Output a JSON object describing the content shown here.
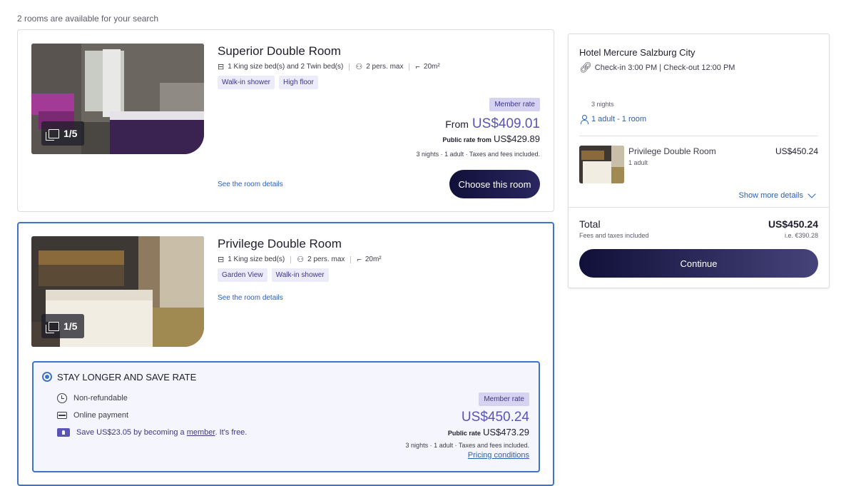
{
  "results": {
    "available_text": "2 rooms are available for your search"
  },
  "rooms": [
    {
      "name": "Superior Double Room",
      "photo_count": "1/5",
      "beds": "1 King size bed(s) and 2 Twin bed(s)",
      "max": "2 pers. max",
      "size": "20m²",
      "tags": [
        "Walk-in shower",
        "High floor"
      ],
      "details_link": "See the room details",
      "member_rate": "Member rate",
      "from_label": "From",
      "from_price": "US$409.01",
      "public_label": "Public rate from",
      "public_price": "US$429.89",
      "taxes_note": "3 nights · 1 adult · Taxes and fees included.",
      "choose_label": "Choose this room"
    },
    {
      "name": "Privilege Double Room",
      "photo_count": "1/5",
      "beds": "1 King size bed(s)",
      "max": "2 pers. max",
      "size": "20m²",
      "tags": [
        "Garden View",
        "Walk-in shower"
      ],
      "details_link": "See the room details",
      "rate": {
        "title": "STAY LONGER AND SAVE RATE",
        "non_refundable": "Non-refundable",
        "payment": "Online payment",
        "save_prefix": "Save US$23.05 by becoming a ",
        "save_link": "member",
        "save_suffix": ". It's free.",
        "member_rate": "Member rate",
        "price": "US$450.24",
        "public_label": "Public rate",
        "public_price": "US$473.29",
        "taxes_note": "3 nights · 1 adult · Taxes and fees included.",
        "pricing_conditions": "Pricing conditions"
      }
    }
  ],
  "summary": {
    "hotel_name": "Hotel Mercure Salzburg City",
    "check_times": "Check-in 3:00 PM | Check-out 12:00 PM",
    "nights": "3 nights",
    "guests": "1 adult - 1 room",
    "room_name": "Privilege Double Room",
    "room_adults": "1 adult",
    "room_price": "US$450.24",
    "show_more": "Show more details",
    "total_label": "Total",
    "total_sub": "Fees and taxes included",
    "total_price": "US$450.24",
    "total_ie": "i.e. €390.28",
    "continue_label": "Continue"
  },
  "icons": [
    "bed-icon",
    "persons-icon",
    "area-icon",
    "gallery-icon",
    "clock-icon",
    "card-icon",
    "member-icon",
    "link-icon",
    "person-icon",
    "chevron-down-icon"
  ],
  "colors": {
    "accent": "#5a54b8",
    "link": "#2d5fb5",
    "button": "#101039",
    "selected_border": "#3f73c9"
  }
}
